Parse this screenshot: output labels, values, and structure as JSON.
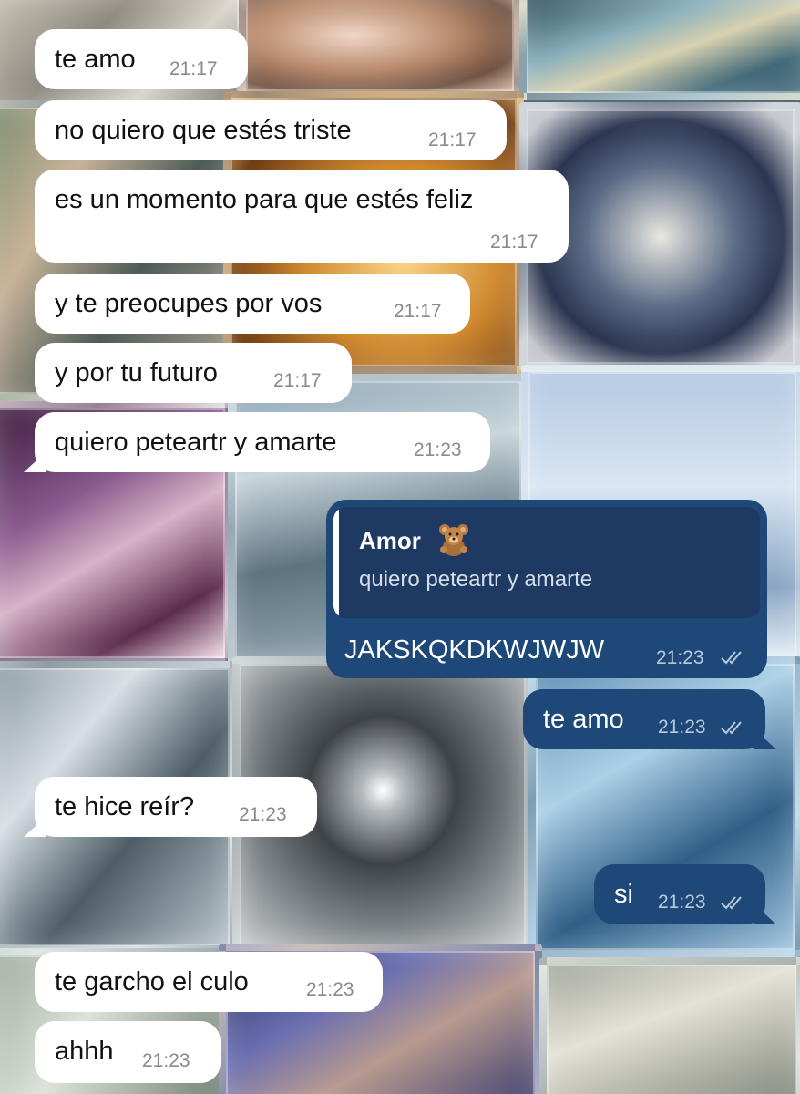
{
  "messages": [
    {
      "text": "te amo",
      "time": "21:17",
      "direction": "incoming"
    },
    {
      "text": "no quiero que estés triste",
      "time": "21:17",
      "direction": "incoming"
    },
    {
      "text": "es un momento para que estés feliz",
      "time": "21:17",
      "direction": "incoming"
    },
    {
      "text": "y te preocupes por vos",
      "time": "21:17",
      "direction": "incoming"
    },
    {
      "text": "y por tu futuro",
      "time": "21:17",
      "direction": "incoming"
    },
    {
      "text": "quiero peteartr y amarte",
      "time": "21:23",
      "direction": "incoming"
    },
    {
      "text": "JAKSKQKDKWJWJW",
      "time": "21:23",
      "direction": "outgoing",
      "reply": {
        "name": "Amor",
        "name_emoji": "teddy-bear-icon",
        "text": "quiero peteartr y amarte"
      },
      "status": "read"
    },
    {
      "text": "te amo",
      "time": "21:23",
      "direction": "outgoing",
      "status": "read"
    },
    {
      "text": "te hice reír?",
      "time": "21:23",
      "direction": "incoming"
    },
    {
      "text": "si",
      "time": "21:23",
      "direction": "outgoing",
      "status": "read"
    },
    {
      "text": "te garcho el culo",
      "time": "21:23",
      "direction": "incoming"
    },
    {
      "text": "ahhh",
      "time": "21:23",
      "direction": "incoming"
    }
  ],
  "colors": {
    "incoming_bubble": "#ffffff",
    "outgoing_bubble": "#1e4878",
    "reply_background": "#1f3a62",
    "timestamp_incoming": "#8a8a8a",
    "timestamp_outgoing": "#b9c9dc"
  }
}
